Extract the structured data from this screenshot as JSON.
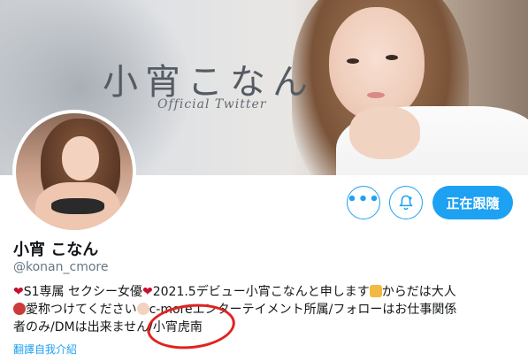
{
  "banner": {
    "title": "小宵こなん",
    "subtitle": "Official Twitter"
  },
  "actions": {
    "more_symbol": "•••",
    "follow_label": "正在跟隨"
  },
  "profile": {
    "display_name": "小宵 こなん",
    "handle": "@konan_cmore",
    "bio": {
      "line1_a": "S1専属 セクシー女優",
      "line1_b": "2021.5デビュー小宵こなんと申します",
      "line1_c": "からだは大人",
      "line2_a": "愛称つけてください",
      "line2_b": "c-moreエンターテイメント所属/フォローはお仕事関係",
      "line3": "者のみ/DMは出来ません/小宵虎南"
    },
    "translate_link": "翻譯自我介紹"
  },
  "colors": {
    "accent": "#1da1f2",
    "annotation_circle": "#e0231f",
    "heart": "#c8102e"
  },
  "icons": [
    "more-dots-icon",
    "bell-plus-icon",
    "heart-icon",
    "tiger-icon",
    "mail-icon",
    "hand-icon"
  ]
}
